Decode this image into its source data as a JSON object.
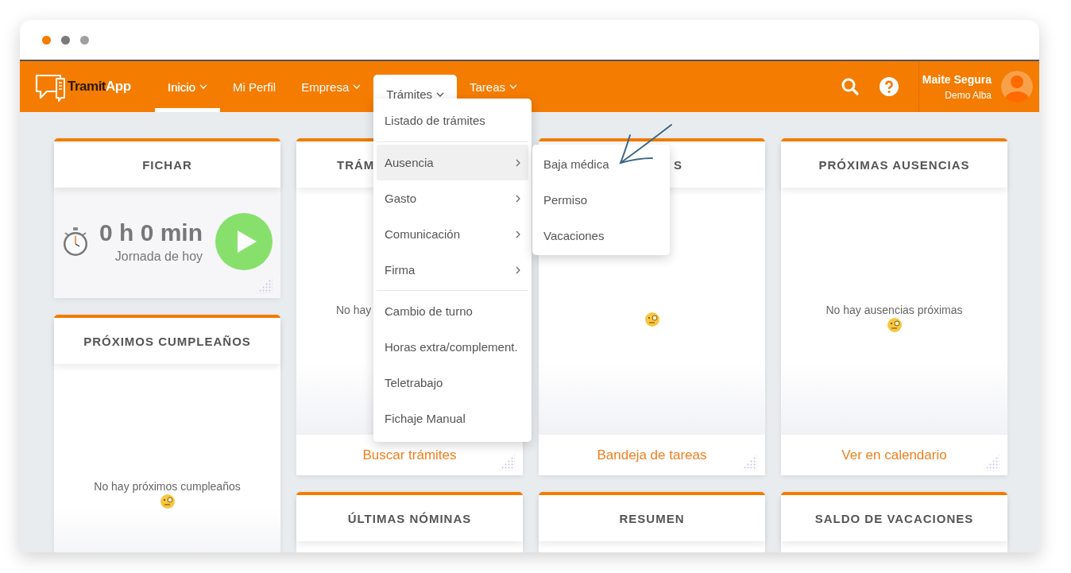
{
  "window": {
    "dots": [
      {
        "color": "#f47c00"
      },
      {
        "color": "#7a7a7a"
      },
      {
        "color": "#a0a0a0"
      }
    ]
  },
  "nav": {
    "logo": {
      "parts": [
        "Tramit",
        "App"
      ]
    },
    "items": [
      {
        "label": "Inicio",
        "has_caret": true,
        "selected": true,
        "expanded": false
      },
      {
        "label": "Mi Perfil",
        "has_caret": false,
        "selected": false,
        "expanded": false
      },
      {
        "label": "Empresa",
        "has_caret": true,
        "selected": false,
        "expanded": false
      },
      {
        "label": "Trámites",
        "has_caret": true,
        "selected": false,
        "expanded": true
      },
      {
        "label": "Tareas",
        "has_caret": true,
        "selected": false,
        "expanded": false
      }
    ],
    "user": {
      "name": "Maite Segura",
      "company": "Demo Alba"
    }
  },
  "menu": {
    "groups": [
      [
        {
          "label": "Listado de trámites",
          "has_submenu": false,
          "selected": false
        }
      ],
      [
        {
          "label": "Ausencia",
          "has_submenu": true,
          "selected": true
        },
        {
          "label": "Gasto",
          "has_submenu": true,
          "selected": false
        },
        {
          "label": "Comunicación",
          "has_submenu": true,
          "selected": false
        },
        {
          "label": "Firma",
          "has_submenu": true,
          "selected": false
        }
      ],
      [
        {
          "label": "Cambio de turno",
          "has_submenu": false,
          "selected": false
        },
        {
          "label": "Horas extra/complement.",
          "has_submenu": false,
          "selected": false
        },
        {
          "label": "Teletrabajo",
          "has_submenu": false,
          "selected": false
        },
        {
          "label": "Fichaje Manual",
          "has_submenu": false,
          "selected": false
        }
      ]
    ],
    "submenu": [
      {
        "label": "Baja médica"
      },
      {
        "label": "Permiso"
      },
      {
        "label": "Vacaciones"
      }
    ]
  },
  "columns": [
    [
      {
        "kind": "timer",
        "title": "FICHAR",
        "time": "0 h 0 min",
        "caption": "Jornada de hoy"
      },
      {
        "kind": "empty",
        "title": "PRÓXIMOS CUMPLEAÑOS",
        "message": "No hay próximos cumpleaños",
        "emoji": true
      }
    ],
    [
      {
        "kind": "empty",
        "title": "TRÁM",
        "message": "No hay",
        "emoji": false,
        "footer_link": "Buscar trámites"
      },
      {
        "kind": "plain",
        "title": "ÚLTIMAS NÓMINAS"
      }
    ],
    [
      {
        "kind": "empty",
        "title": "S",
        "emoji": true,
        "footer_link": "Bandeja de tareas"
      },
      {
        "kind": "plain",
        "title": "RESUMEN"
      }
    ],
    [
      {
        "kind": "empty",
        "title": "PRÓXIMAS AUSENCIAS",
        "message": "No hay ausencias próximas",
        "emoji": true,
        "footer_link": "Ver en calendario"
      },
      {
        "kind": "plain",
        "title": "SALDO DE VACACIONES"
      }
    ]
  ]
}
